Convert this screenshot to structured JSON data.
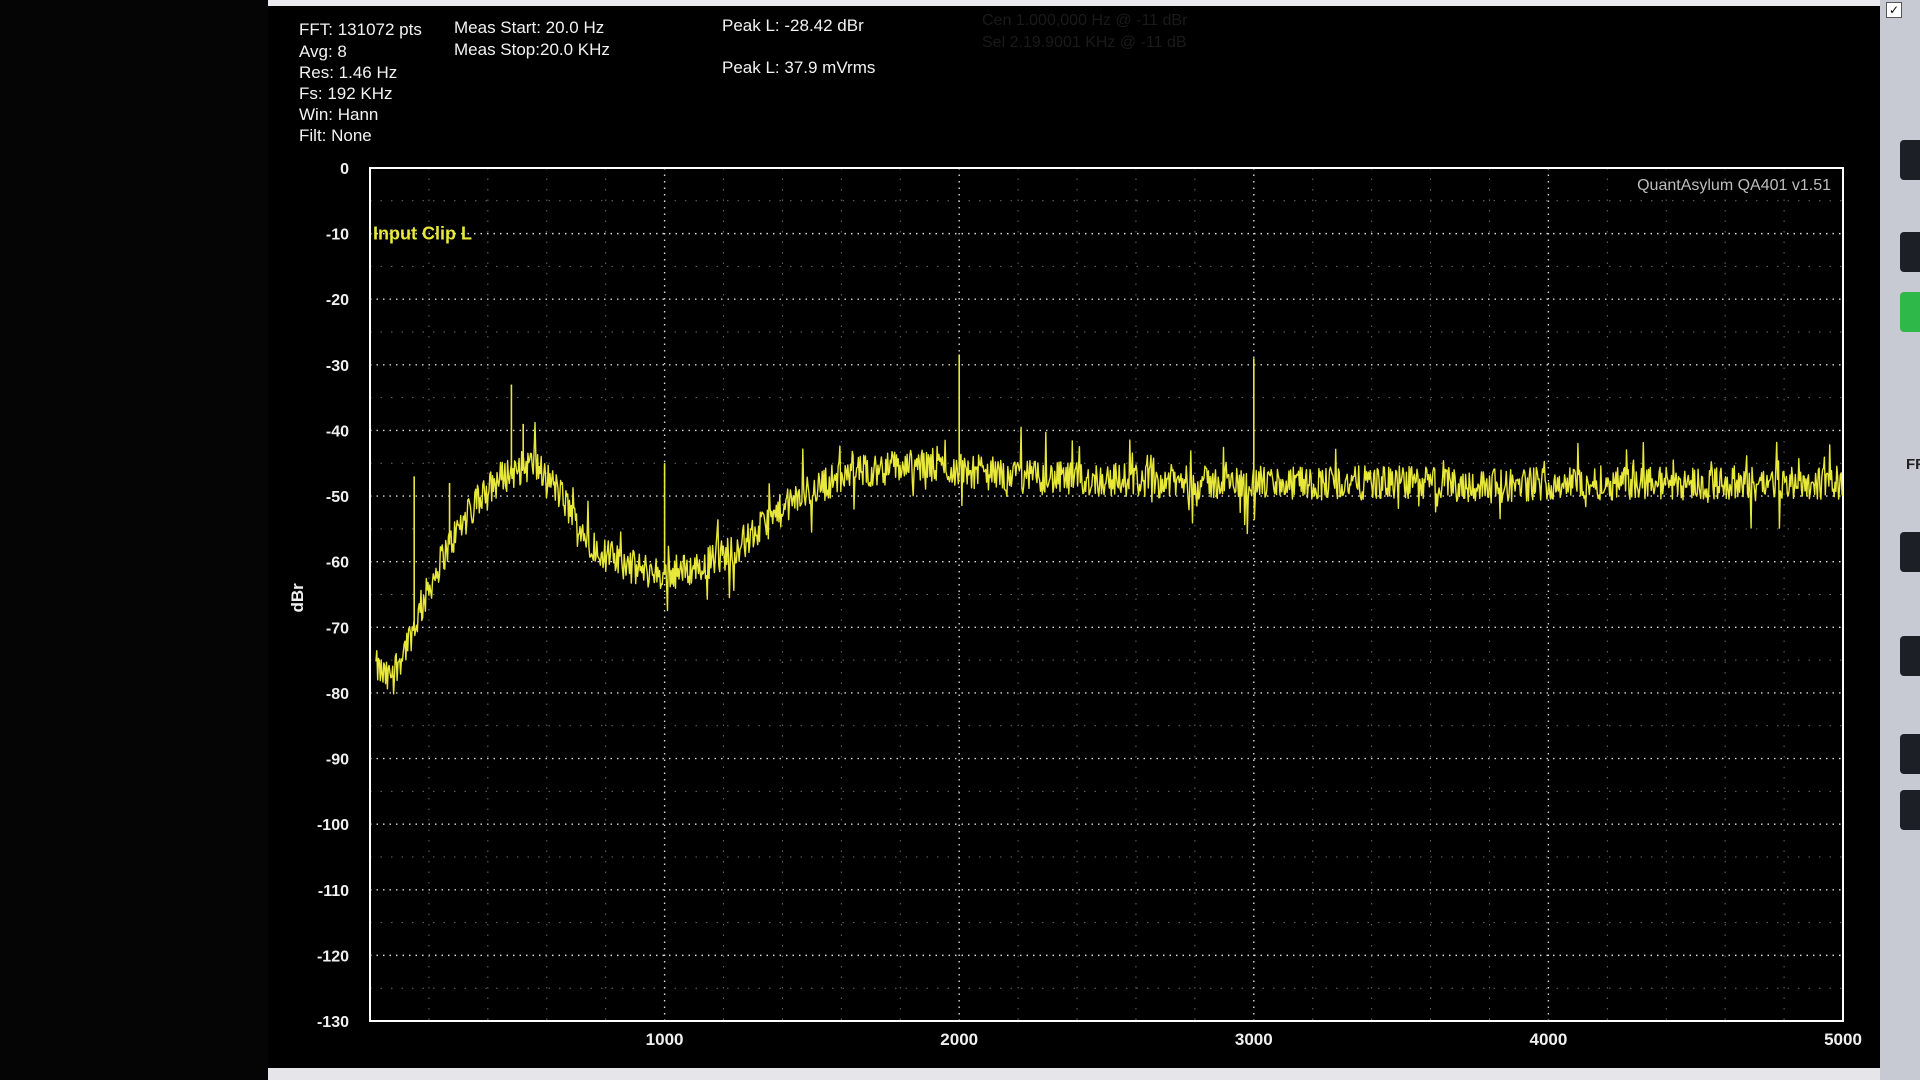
{
  "info": {
    "fft": "FFT: 131072 pts",
    "avg": "Avg: 8",
    "res": "Res: 1.46 Hz",
    "fs": "Fs: 192 KHz",
    "win": "Win: Hann",
    "filt": "Filt: None",
    "meas_start": "Meas Start: 20.0 Hz",
    "meas_stop": "Meas Stop:20.0 KHz",
    "peak_dbr": "Peak L: -28.42 dBr",
    "peak_vrms": "Peak L: 37.9 mVrms",
    "ghost_line1": "Cen 1.000,000 Hz @ -11 dBr",
    "ghost_line2": "Sel 2.19.9001 KHz @ -11 dB"
  },
  "right_panel": {
    "partial_label": "FF"
  },
  "chart_data": {
    "type": "line",
    "title": "",
    "watermark": "QuantAsylum QA401 v1.51",
    "series_label": "Input Clip L",
    "ylabel": "dBr",
    "xlabel": "",
    "xlim": [
      0,
      5000
    ],
    "ylim": [
      -130,
      0
    ],
    "yticks": [
      0,
      -10,
      -20,
      -30,
      -40,
      -50,
      -60,
      -70,
      -80,
      -90,
      -100,
      -110,
      -120,
      -130
    ],
    "xticks": [
      1000,
      2000,
      3000,
      4000,
      5000
    ],
    "grid": true,
    "line_color": "#e8e83a",
    "series": [
      {
        "name": "Input Clip L",
        "x": [
          20,
          60,
          100,
          150,
          200,
          250,
          300,
          350,
          400,
          450,
          500,
          550,
          600,
          650,
          700,
          750,
          800,
          900,
          1000,
          1100,
          1200,
          1300,
          1400,
          1500,
          1600,
          1700,
          1800,
          1900,
          2000,
          2200,
          2400,
          2600,
          2800,
          3000,
          3200,
          3400,
          3600,
          3800,
          4000,
          4200,
          4400,
          4600,
          4800,
          5000
        ],
        "y": [
          -76,
          -78,
          -75,
          -70,
          -64,
          -59,
          -55,
          -52,
          -49,
          -47,
          -46,
          -45,
          -47,
          -50,
          -54,
          -57,
          -59,
          -61,
          -62,
          -61,
          -59,
          -56,
          -52,
          -49,
          -47,
          -46,
          -45.5,
          -45.5,
          -46,
          -47,
          -47.5,
          -47.5,
          -48,
          -48,
          -48,
          -48,
          -48,
          -48.5,
          -48,
          -48,
          -48,
          -48,
          -48,
          -48
        ]
      }
    ],
    "spikes": [
      {
        "x": 150,
        "y": -47
      },
      {
        "x": 270,
        "y": -48
      },
      {
        "x": 480,
        "y": -33
      },
      {
        "x": 520,
        "y": -39
      },
      {
        "x": 1000,
        "y": -45
      },
      {
        "x": 2000,
        "y": -28.42
      },
      {
        "x": 3000,
        "y": -29
      }
    ]
  }
}
